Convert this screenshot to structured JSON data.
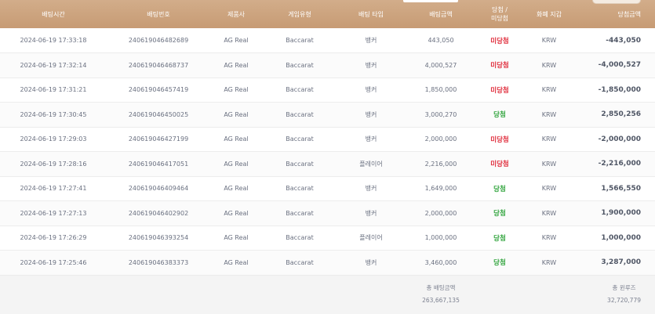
{
  "table": {
    "headers": {
      "bet_time": "배팅시간",
      "bet_number": "배팅번호",
      "provider": "제품사",
      "game_type": "게임유형",
      "bet_type": "배팅 타입",
      "bet_amount": "배팅금액",
      "result_line1": "당첨 /",
      "result_line2": "미당첨",
      "currency": "화폐 지갑",
      "win_amount": "당첨금액"
    },
    "rows": [
      {
        "time": "2024-06-19 17:33:18",
        "number": "240619046482689",
        "provider": "AG Real",
        "game": "Baccarat",
        "bet_type": "뱅커",
        "amount": "443,050",
        "result": "미당첨",
        "result_kind": "lose",
        "currency": "KRW",
        "win": "-443,050"
      },
      {
        "time": "2024-06-19 17:32:14",
        "number": "240619046468737",
        "provider": "AG Real",
        "game": "Baccarat",
        "bet_type": "뱅커",
        "amount": "4,000,527",
        "result": "미당첨",
        "result_kind": "lose",
        "currency": "KRW",
        "win": "-4,000,527"
      },
      {
        "time": "2024-06-19 17:31:21",
        "number": "240619046457419",
        "provider": "AG Real",
        "game": "Baccarat",
        "bet_type": "뱅커",
        "amount": "1,850,000",
        "result": "미당첨",
        "result_kind": "lose",
        "currency": "KRW",
        "win": "-1,850,000"
      },
      {
        "time": "2024-06-19 17:30:45",
        "number": "240619046450025",
        "provider": "AG Real",
        "game": "Baccarat",
        "bet_type": "뱅커",
        "amount": "3,000,270",
        "result": "당첨",
        "result_kind": "win",
        "currency": "KRW",
        "win": "2,850,256"
      },
      {
        "time": "2024-06-19 17:29:03",
        "number": "240619046427199",
        "provider": "AG Real",
        "game": "Baccarat",
        "bet_type": "뱅커",
        "amount": "2,000,000",
        "result": "미당첨",
        "result_kind": "lose",
        "currency": "KRW",
        "win": "-2,000,000"
      },
      {
        "time": "2024-06-19 17:28:16",
        "number": "240619046417051",
        "provider": "AG Real",
        "game": "Baccarat",
        "bet_type": "플레이어",
        "amount": "2,216,000",
        "result": "미당첨",
        "result_kind": "lose",
        "currency": "KRW",
        "win": "-2,216,000"
      },
      {
        "time": "2024-06-19 17:27:41",
        "number": "240619046409464",
        "provider": "AG Real",
        "game": "Baccarat",
        "bet_type": "뱅커",
        "amount": "1,649,000",
        "result": "당첨",
        "result_kind": "win",
        "currency": "KRW",
        "win": "1,566,550"
      },
      {
        "time": "2024-06-19 17:27:13",
        "number": "240619046402902",
        "provider": "AG Real",
        "game": "Baccarat",
        "bet_type": "뱅커",
        "amount": "2,000,000",
        "result": "당첨",
        "result_kind": "win",
        "currency": "KRW",
        "win": "1,900,000"
      },
      {
        "time": "2024-06-19 17:26:29",
        "number": "240619046393254",
        "provider": "AG Real",
        "game": "Baccarat",
        "bet_type": "플레이어",
        "amount": "1,000,000",
        "result": "당첨",
        "result_kind": "win",
        "currency": "KRW",
        "win": "1,000,000"
      },
      {
        "time": "2024-06-19 17:25:46",
        "number": "240619046383373",
        "provider": "AG Real",
        "game": "Baccarat",
        "bet_type": "뱅커",
        "amount": "3,460,000",
        "result": "당첨",
        "result_kind": "win",
        "currency": "KRW",
        "win": "3,287,000"
      }
    ],
    "summary": {
      "total_bet_label": "총 배팅금액",
      "total_bet_value": "263,667,135",
      "total_win_label": "총 윈루즈",
      "total_win_value": "32,720,779"
    }
  },
  "colors": {
    "header_bg": "#c9a07a",
    "lose": "#e02d3c",
    "win": "#33a53f"
  }
}
